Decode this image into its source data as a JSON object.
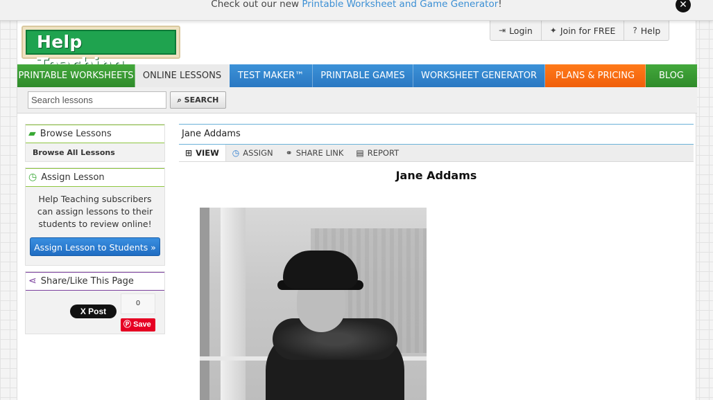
{
  "notice": {
    "text_before": "Check out our new ",
    "link_text": "Printable Worksheet and Game Generator",
    "text_after": "!",
    "close_glyph": "✕"
  },
  "logo": {
    "text": "Help Teaching"
  },
  "top_links": [
    {
      "label": "Login",
      "icon": "sign-in-icon",
      "glyph": "⇥"
    },
    {
      "label": "Join for FREE",
      "icon": "person-icon",
      "glyph": "✦"
    },
    {
      "label": "Help",
      "icon": "question-icon",
      "glyph": "?"
    }
  ],
  "nav": [
    {
      "label": "PRINTABLE WORKSHEETS"
    },
    {
      "label": "ONLINE LESSONS"
    },
    {
      "label": "TEST MAKER™"
    },
    {
      "label": "PRINTABLE GAMES"
    },
    {
      "label": "WORKSHEET GENERATOR"
    },
    {
      "label": "PLANS & PRICING"
    },
    {
      "label": "BLOG"
    }
  ],
  "search": {
    "placeholder": "Search lessons",
    "button": "SEARCH",
    "button_glyph": "⌕"
  },
  "sidebar": {
    "browse_title": "Browse Lessons",
    "browse_link": "Browse All Lessons",
    "assign_title": "Assign Lesson",
    "assign_text": "Help Teaching subscribers can assign lessons to their students to review online!",
    "assign_button": "Assign Lesson to Students »",
    "share_title": "Share/Like This Page",
    "x_post": "X Post",
    "count": "0",
    "pin_save": "Save"
  },
  "content": {
    "breadcrumb": "Jane Addams",
    "tabs": [
      {
        "label": "VIEW",
        "glyph": "⊞"
      },
      {
        "label": "ASSIGN",
        "glyph": "◷"
      },
      {
        "label": "SHARE LINK",
        "glyph": "⚭"
      },
      {
        "label": "REPORT",
        "glyph": "▤"
      }
    ],
    "title": "Jane Addams"
  }
}
